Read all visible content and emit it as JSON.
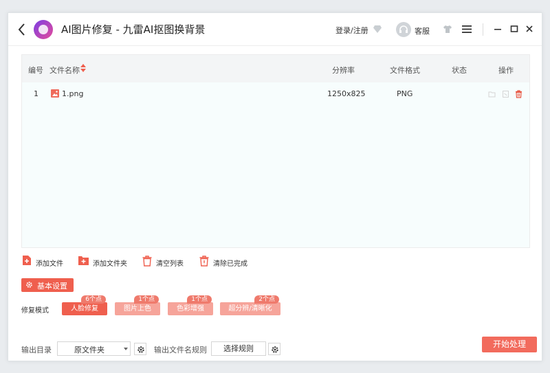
{
  "app": {
    "title": "AI图片修复 - 九雷AI抠图换背景",
    "login_label": "登录/注册",
    "service_label": "客服"
  },
  "table": {
    "headers": {
      "index": "编号",
      "name": "文件名称",
      "resolution": "分辨率",
      "format": "文件格式",
      "status": "状态",
      "actions": "操作"
    },
    "rows": [
      {
        "index": "1",
        "name": "1.png",
        "resolution": "1250x825",
        "format": "PNG",
        "status": ""
      }
    ]
  },
  "actions": {
    "add_file": "添加文件",
    "add_folder": "添加文件夹",
    "clear_list": "清空列表",
    "clear_done": "清除已完成"
  },
  "settings": {
    "basic_label": "基本设置",
    "mode_label": "修复模式",
    "modes": [
      {
        "label": "人脸修复",
        "badge": "6个点"
      },
      {
        "label": "图片上色",
        "badge": "1个点"
      },
      {
        "label": "色彩增强",
        "badge": "1个点"
      },
      {
        "label": "超分辨/清晰化",
        "badge": "2个点"
      }
    ]
  },
  "output": {
    "dir_label": "输出目录",
    "dir_value": "原文件夹",
    "rule_label": "输出文件名规则",
    "rule_button": "选择规则",
    "start_button": "开始处理"
  },
  "colors": {
    "accent": "#ef5f4e",
    "accent_light": "#f6a49a",
    "delete_icon": "#e8533f"
  },
  "icons": {
    "back": "chevron-left-icon",
    "diamond": "diamond-icon",
    "tshirt": "tshirt-icon",
    "menu": "hamburger-menu-icon",
    "minimize": "minimize-icon",
    "maximize": "maximize-icon",
    "close": "close-icon"
  }
}
